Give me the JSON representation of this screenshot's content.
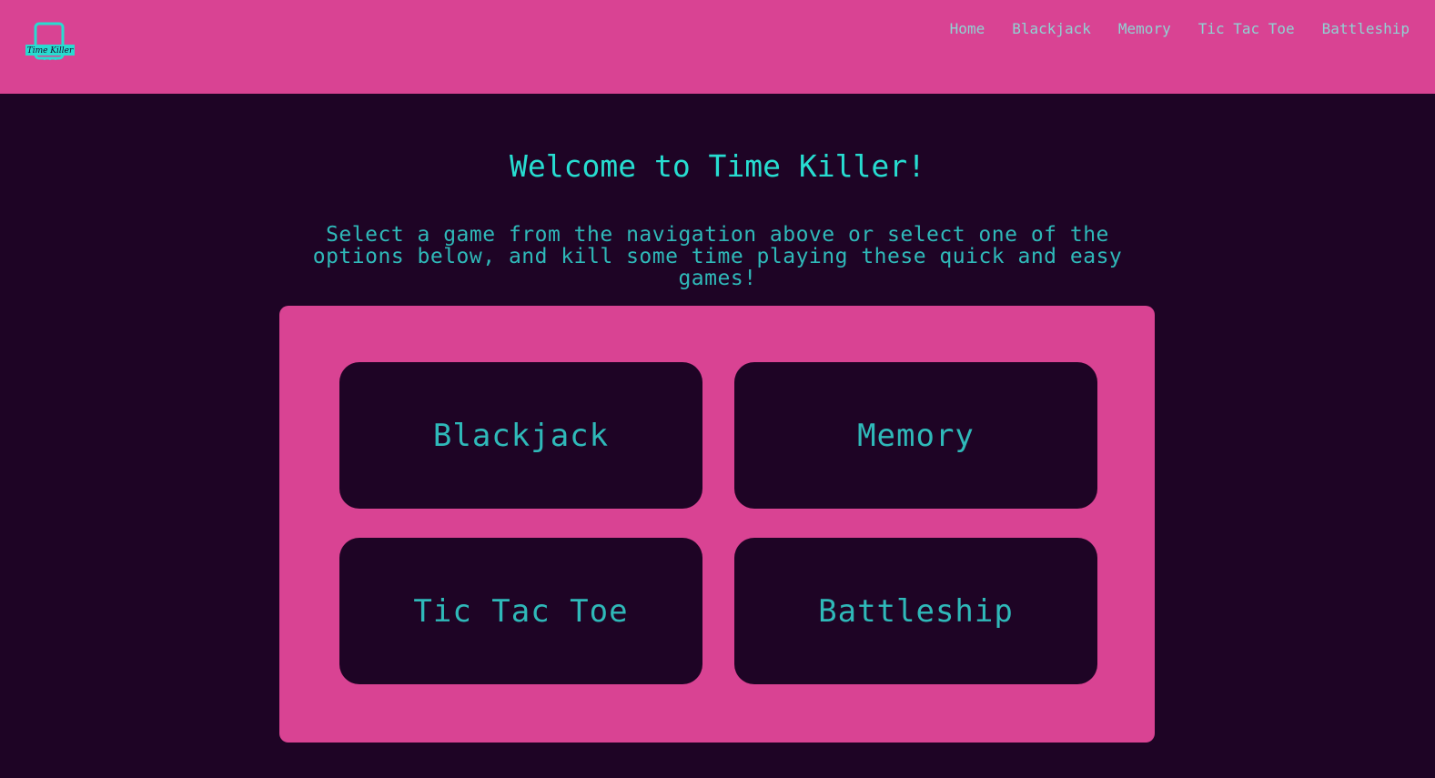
{
  "brand": {
    "logo_text": "Time Killer",
    "logo_icon": "phone-logo-icon",
    "accent_color": "#27dcd0",
    "header_color": "#d94393",
    "background_color": "#1e0425"
  },
  "nav": {
    "items": [
      {
        "label": "Home"
      },
      {
        "label": "Blackjack"
      },
      {
        "label": "Memory"
      },
      {
        "label": "Tic Tac Toe"
      },
      {
        "label": "Battleship"
      }
    ]
  },
  "main": {
    "title": "Welcome to Time Killer!",
    "intro": "Select a game from the navigation above or select one of the options below, and kill some time playing these quick and easy games!",
    "games": [
      {
        "label": "Blackjack"
      },
      {
        "label": "Memory"
      },
      {
        "label": "Tic Tac Toe"
      },
      {
        "label": "Battleship"
      }
    ]
  }
}
